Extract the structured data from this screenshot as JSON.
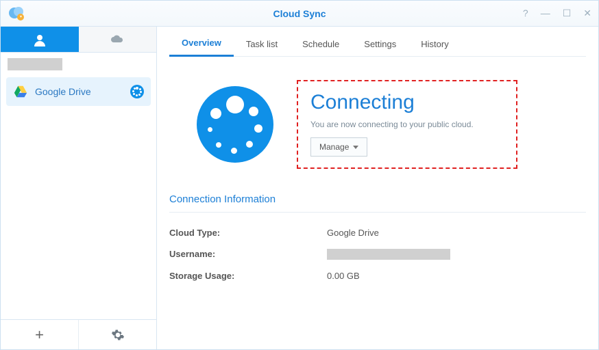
{
  "window": {
    "title": "Cloud Sync"
  },
  "sidebar": {
    "connection": {
      "name": "Google Drive"
    }
  },
  "tabs": {
    "overview": "Overview",
    "tasklist": "Task list",
    "schedule": "Schedule",
    "settings": "Settings",
    "history": "History"
  },
  "status": {
    "title": "Connecting",
    "subtitle": "You are now connecting to your public cloud.",
    "manage": "Manage"
  },
  "section": {
    "title": "Connection Information"
  },
  "info": {
    "cloud_type_label": "Cloud Type:",
    "cloud_type_value": "Google Drive",
    "username_label": "Username:",
    "storage_label": "Storage Usage:",
    "storage_value": "0.00 GB"
  }
}
